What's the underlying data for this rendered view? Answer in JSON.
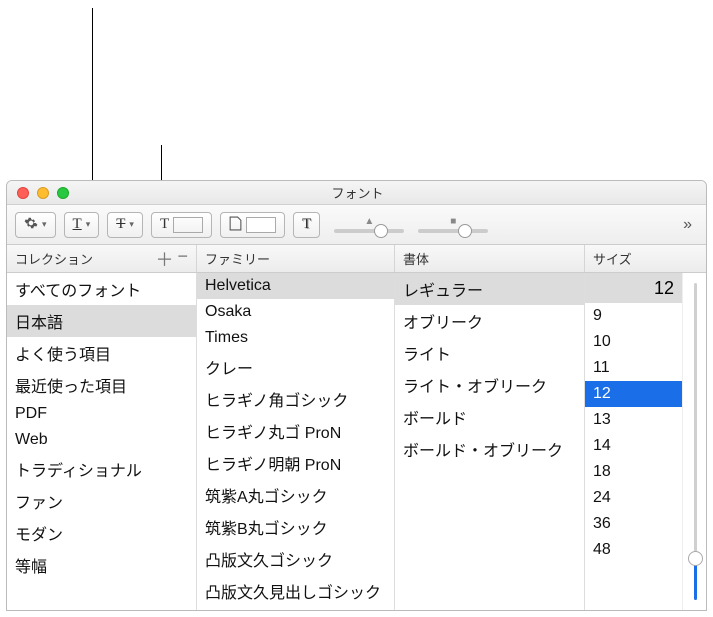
{
  "window_title": "フォント",
  "headers": {
    "collection": "コレクション",
    "family": "ファミリー",
    "typeface": "書体",
    "size": "サイズ"
  },
  "collections": [
    "すべてのフォント",
    "日本語",
    "よく使う項目",
    "最近使った項目",
    "PDF",
    "Web",
    "トラディショナル",
    "ファン",
    "モダン",
    "等幅"
  ],
  "collections_selected_index": 1,
  "families": [
    "Helvetica",
    "Osaka",
    "Times",
    "クレー",
    "ヒラギノ角ゴシック",
    "ヒラギノ丸ゴ ProN",
    "ヒラギノ明朝 ProN",
    "筑紫A丸ゴシック",
    "筑紫B丸ゴシック",
    "凸版文久ゴシック",
    "凸版文久見出しゴシック"
  ],
  "families_selected_index": 0,
  "typefaces": [
    "レギュラー",
    "オブリーク",
    "ライト",
    "ライト・オブリーク",
    "ボールド",
    "ボールド・オブリーク"
  ],
  "typefaces_selected_index": 0,
  "sizes": [
    "9",
    "10",
    "11",
    "12",
    "13",
    "14",
    "18",
    "24",
    "36",
    "48"
  ],
  "sizes_selected_index": 3,
  "size_value": "12",
  "icons": {
    "gear": "gear-icon",
    "underline": "underline-icon",
    "strike": "strikethrough-icon",
    "textcolor": "text-color-icon",
    "pagecolor": "page-color-icon",
    "effects": "text-effects-icon",
    "plus": "＋",
    "minus": "−"
  },
  "colors": {
    "text_swatch": "#000000",
    "page_swatch": "#ffffff"
  }
}
